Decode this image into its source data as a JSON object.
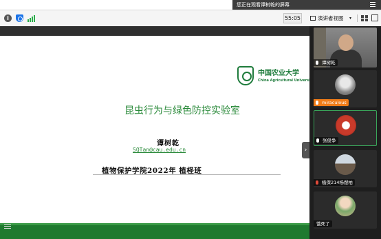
{
  "banner": {
    "text": "您正在观看谭树乾的屏幕"
  },
  "toolbar": {
    "timer": "55:05",
    "view_label": "演讲者视图",
    "info_glyph": "i",
    "caret": "▾"
  },
  "slide": {
    "logo_cn": "中国农业大学",
    "logo_en": "China Agricultural University",
    "title": "昆虫行为与绿色防控实验室",
    "presenter": "谭树乾",
    "email": "SQTan@cau.edu.cn",
    "class_line": "植物保护学院2022年 植柽班",
    "next_arrow": "›"
  },
  "participants": [
    {
      "name": "谭树乾",
      "mic": "on",
      "video": true
    },
    {
      "name": "miraculous",
      "mic": "on",
      "video": false,
      "label_color": "#f07c18"
    },
    {
      "name": "张俊争",
      "mic": "on",
      "video": false,
      "active": true
    },
    {
      "name": "植保214杨煜柏",
      "mic": "muted",
      "video": false
    },
    {
      "name": "饿死了",
      "mic": "none",
      "video": false
    }
  ],
  "colors": {
    "accent_green": "#2a8a3a",
    "slide_footer": "#1f7a2f",
    "active_border": "#3aa55a",
    "label_orange": "#f07c18"
  },
  "icons": [
    "info-icon",
    "shield-icon",
    "signal-icon",
    "grid-icon",
    "tile-view-icon",
    "fullscreen-icon",
    "menu-icon",
    "chat-icon",
    "mic-icon",
    "next-slide-icon"
  ]
}
